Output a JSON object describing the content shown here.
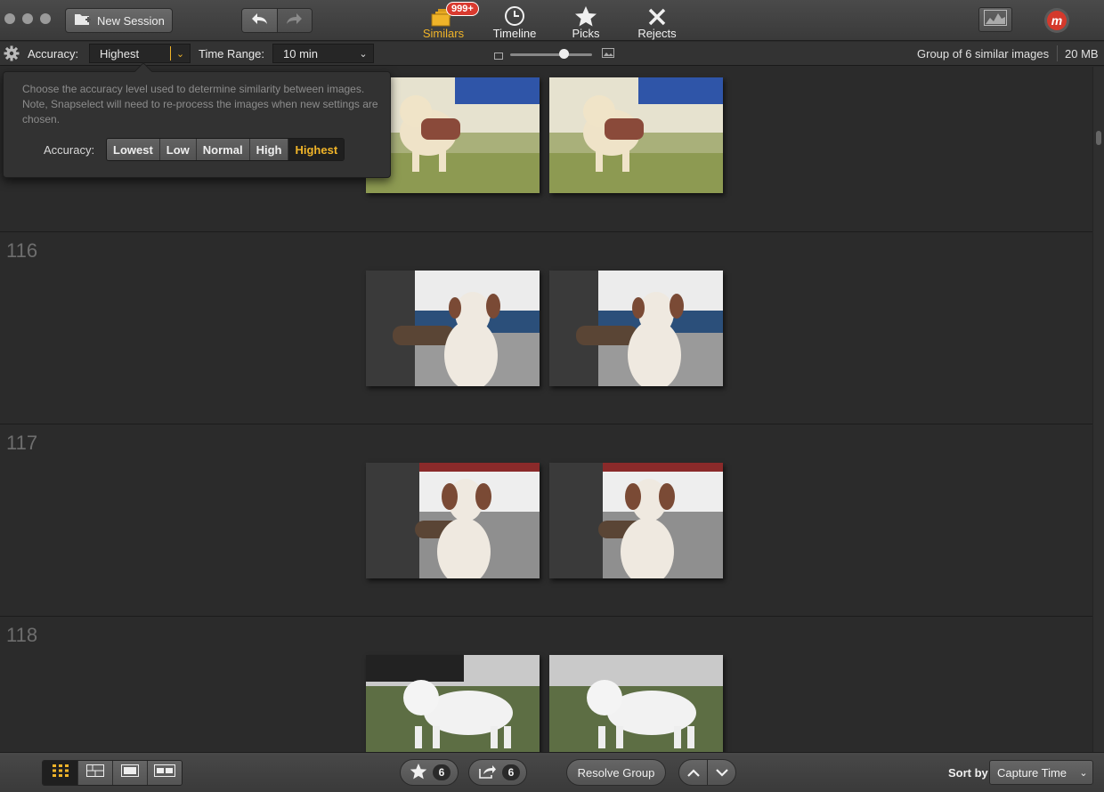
{
  "toolbar": {
    "new_session_label": "New Session",
    "modes": [
      {
        "label": "Similars",
        "badge": "999+",
        "active": true
      },
      {
        "label": "Timeline"
      },
      {
        "label": "Picks"
      },
      {
        "label": "Rejects"
      }
    ],
    "accuracy_label": "Accuracy:",
    "accuracy_value": "Highest",
    "time_range_label": "Time Range:",
    "time_range_value": "10 min",
    "group_info": "Group of 6 similar images",
    "size_info": "20 MB"
  },
  "popover": {
    "description": "Choose the accuracy level used to determine similarity between images. Note, Snapselect will need to re-process the images when new settings are chosen.",
    "accuracy_label": "Accuracy:",
    "options": [
      "Lowest",
      "Low",
      "Normal",
      "High",
      "Highest"
    ],
    "selected": "Highest"
  },
  "groups": [
    {
      "number": "",
      "subject": "shih-tzu"
    },
    {
      "number": "116",
      "subject": "pointer-side"
    },
    {
      "number": "117",
      "subject": "pointer-front"
    },
    {
      "number": "118",
      "subject": "poodle"
    }
  ],
  "bottom": {
    "picks_count": "6",
    "shares_count": "6",
    "resolve_label": "Resolve Group",
    "sort_label": "Sort by:",
    "sort_value": "Capture Time"
  },
  "colors": {
    "accent": "#f0b429",
    "badge": "#d93a2f",
    "background": "#2b2b2b"
  }
}
